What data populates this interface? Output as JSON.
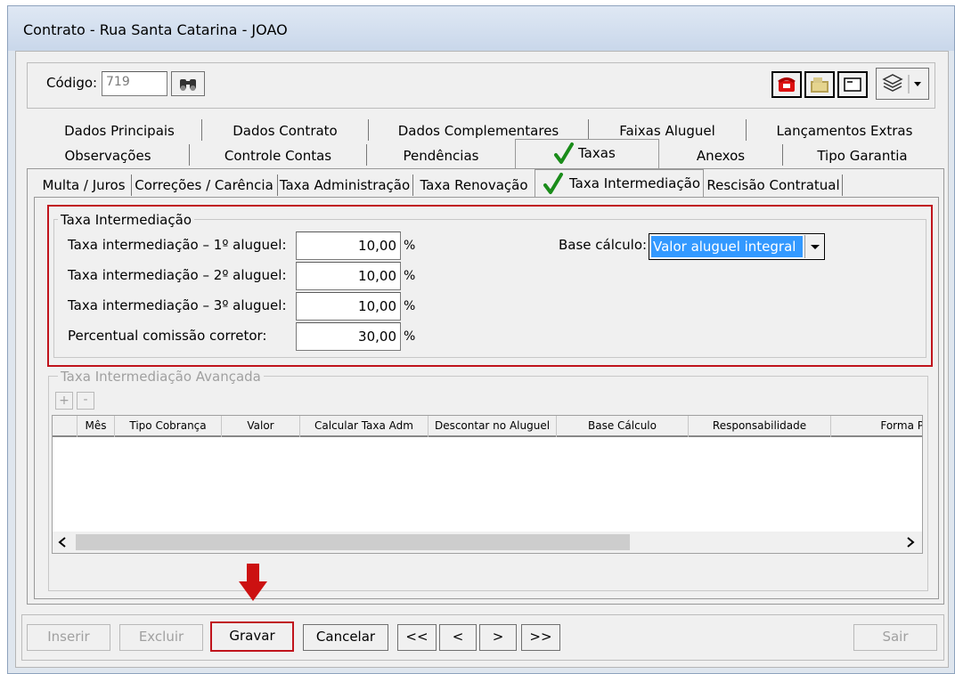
{
  "window": {
    "title": "Contrato - Rua Santa Catarina - JOAO"
  },
  "header": {
    "codigo_label": "Código:",
    "codigo_value": "719"
  },
  "tabs_row1": [
    "Dados Principais",
    "Dados Contrato",
    "Dados Complementares",
    "Faixas Aluguel",
    "Lançamentos Extras"
  ],
  "tabs_row2": [
    "Observações",
    "Controle Contas",
    "Pendências",
    "Taxas",
    "Anexos",
    "Tipo Garantia"
  ],
  "subtabs": [
    "Multa / Juros",
    "Correções / Carência",
    "Taxa Administração",
    "Taxa Renovação",
    "Taxa Intermediação",
    "Rescisão Contratual"
  ],
  "group1": {
    "title": "Taxa Intermediação",
    "rows": [
      {
        "label": "Taxa intermediação – 1º aluguel:",
        "value": "10,00",
        "unit": "%"
      },
      {
        "label": "Taxa intermediação – 2º aluguel:",
        "value": "10,00",
        "unit": "%"
      },
      {
        "label": "Taxa intermediação – 3º aluguel:",
        "value": "10,00",
        "unit": "%"
      },
      {
        "label": "Percentual comissão corretor:",
        "value": "30,00",
        "unit": "%"
      }
    ],
    "base_label": "Base cálculo:",
    "base_value": "Valor aluguel integral"
  },
  "group2": {
    "title": "Taxa Intermediação Avançada",
    "add_label": "+",
    "remove_label": "-",
    "columns": [
      "Mês",
      "Tipo Cobrança",
      "Valor",
      "Calcular Taxa Adm",
      "Descontar no Aluguel",
      "Base Cálculo",
      "Responsabilidade",
      "Forma P"
    ]
  },
  "footer": {
    "inserir": "Inserir",
    "excluir": "Excluir",
    "gravar": "Gravar",
    "cancelar": "Cancelar",
    "first": "<<",
    "prev": "<",
    "next": ">",
    "last": ">>",
    "sair": "Sair"
  },
  "colors": {
    "highlight_red": "#c0141c",
    "check_green": "#1a8c1a",
    "select_blue": "#3399ff",
    "arrow_red": "#cc1111"
  }
}
